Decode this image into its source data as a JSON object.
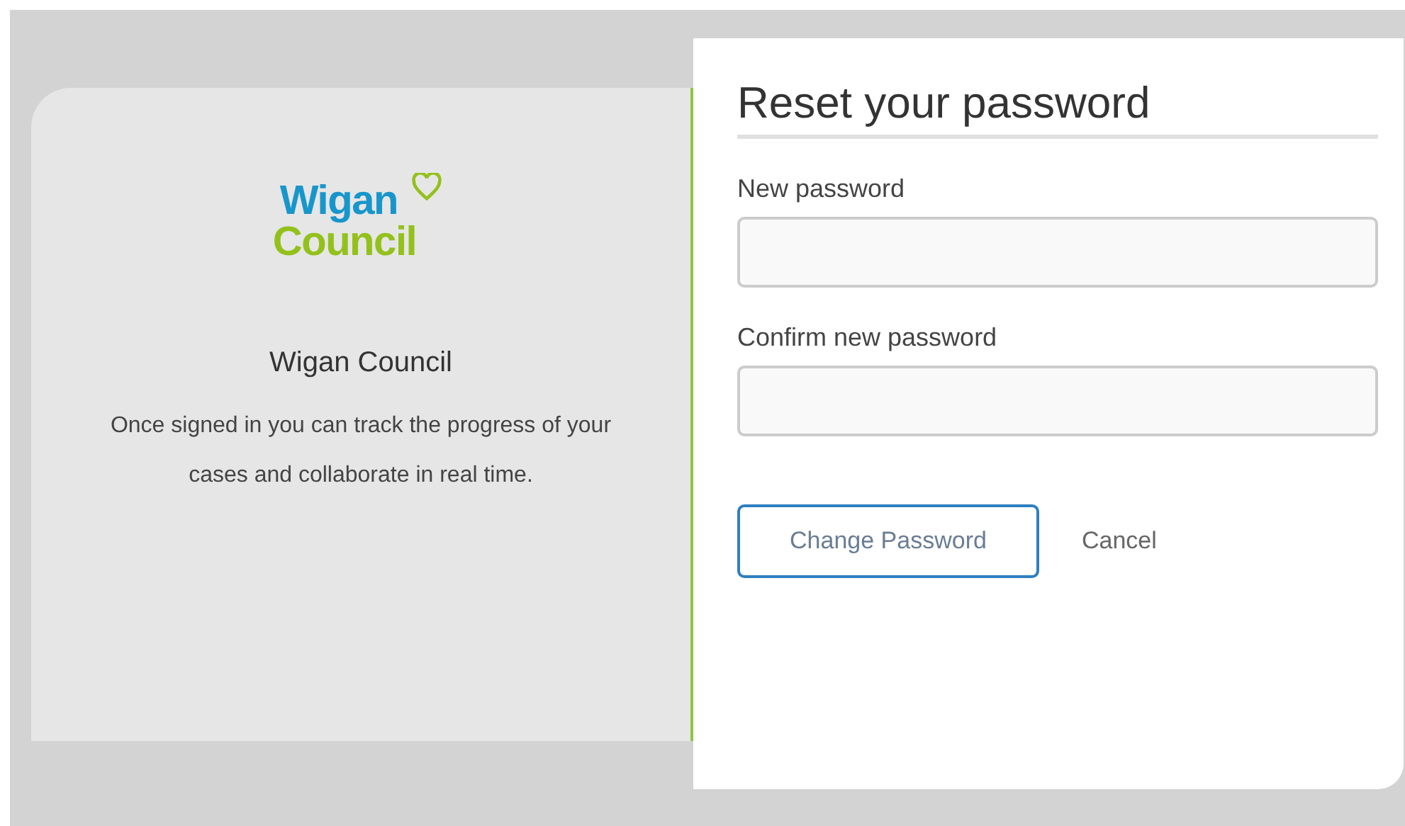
{
  "logo": {
    "line_1": "Wigan",
    "line_2": "Council"
  },
  "info": {
    "name": "Wigan Council",
    "description": "Once signed in you can track the progress of your cases and collaborate in real time."
  },
  "form": {
    "title": "Reset your password",
    "fields": [
      {
        "label": "New password"
      },
      {
        "label": "Confirm new password"
      }
    ],
    "submit": "Change Password",
    "cancel": "Cancel"
  }
}
